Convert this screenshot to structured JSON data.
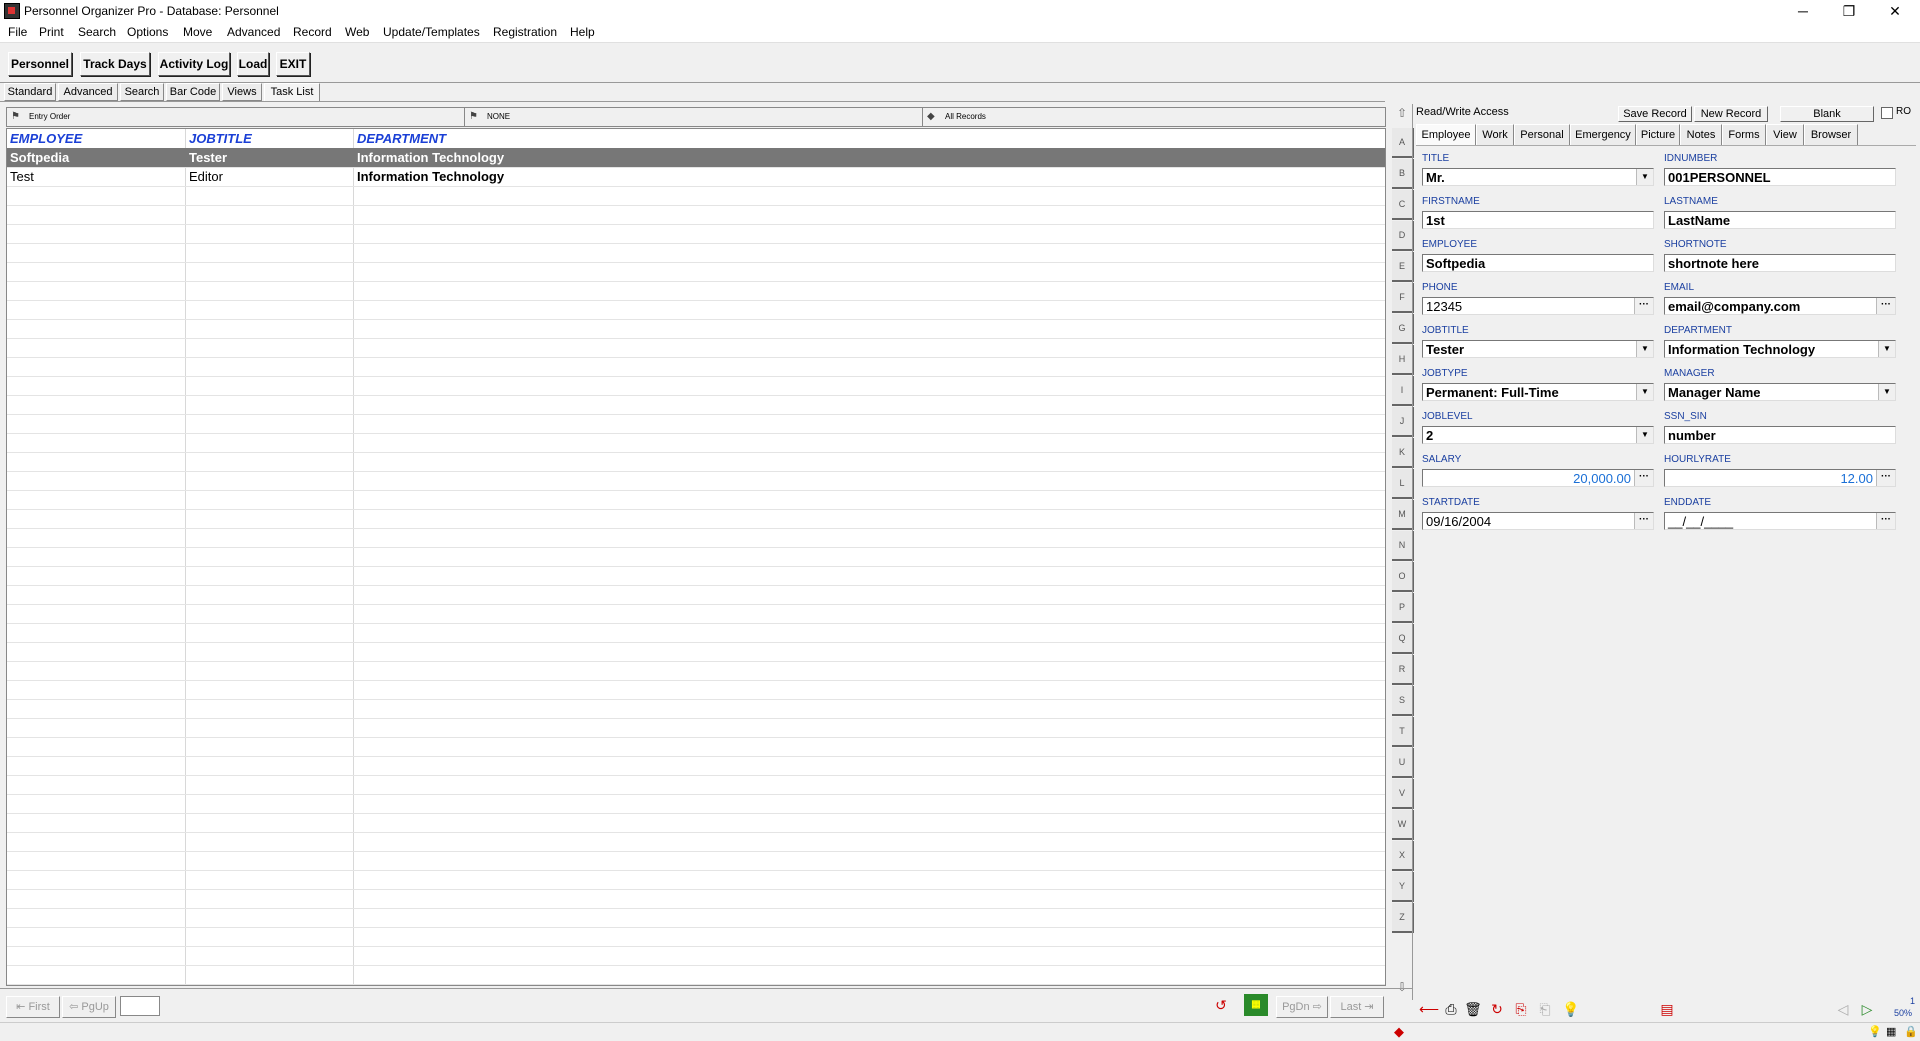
{
  "window": {
    "title": "Personnel Organizer Pro - Database: Personnel",
    "minimize": "─",
    "restore": "❐",
    "close": "✕"
  },
  "menu": [
    "File",
    "Print",
    "Search",
    "Options",
    "Move",
    "Advanced",
    "Record",
    "Web",
    "Update/Templates",
    "Registration",
    "Help"
  ],
  "toolbar": {
    "personnel": "Personnel",
    "track_days": "Track Days",
    "activity_log": "Activity Log",
    "load": "Load",
    "exit": "EXIT"
  },
  "view_tabs": [
    "Standard",
    "Advanced",
    "Search",
    "Bar Code",
    "Views",
    "Task List"
  ],
  "sortbars": {
    "order": "Entry Order",
    "filter": "NONE",
    "records": "All Records"
  },
  "grid": {
    "columns": [
      "EMPLOYEE",
      "JOBTITLE",
      "DEPARTMENT"
    ],
    "rows": [
      [
        "Softpedia",
        "Tester",
        "Information Technology"
      ],
      [
        "Test",
        "Editor",
        "Information Technology"
      ]
    ]
  },
  "alphabet": [
    "A",
    "B",
    "C",
    "D",
    "E",
    "F",
    "G",
    "H",
    "I",
    "J",
    "K",
    "L",
    "M",
    "N",
    "O",
    "P",
    "Q",
    "R",
    "S",
    "T",
    "U",
    "V",
    "W",
    "X",
    "Y",
    "Z"
  ],
  "form": {
    "access": "Read/Write Access",
    "save": "Save Record",
    "new": "New Record",
    "blank": "Blank",
    "ro": "RO",
    "tabs": [
      "Employee",
      "Work",
      "Personal",
      "Emergency",
      "Picture",
      "Notes",
      "Forms",
      "View",
      "Browser"
    ],
    "fields": {
      "title": {
        "label": "TITLE",
        "value": "Mr."
      },
      "idnumber": {
        "label": "IDNUMBER",
        "value": "001PERSONNEL"
      },
      "firstname": {
        "label": "FIRSTNAME",
        "value": "1st"
      },
      "lastname": {
        "label": "LASTNAME",
        "value": "LastName"
      },
      "employee": {
        "label": "EMPLOYEE",
        "value": "Softpedia"
      },
      "shortnote": {
        "label": "SHORTNOTE",
        "value": "shortnote here"
      },
      "phone": {
        "label": "PHONE",
        "value": "12345"
      },
      "email": {
        "label": "EMAIL",
        "value": "email@company.com"
      },
      "jobtitle": {
        "label": "JOBTITLE",
        "value": "Tester"
      },
      "department": {
        "label": "DEPARTMENT",
        "value": "Information Technology"
      },
      "jobtype": {
        "label": "JOBTYPE",
        "value": "Permanent: Full-Time"
      },
      "manager": {
        "label": "MANAGER",
        "value": "Manager Name"
      },
      "joblevel": {
        "label": "JOBLEVEL",
        "value": "2"
      },
      "ssn": {
        "label": "SSN_SIN",
        "value": "number"
      },
      "salary": {
        "label": "SALARY",
        "value": "20,000.00"
      },
      "hourlyrate": {
        "label": "HOURLYRATE",
        "value": "12.00"
      },
      "startdate": {
        "label": "STARTDATE",
        "value": "09/16/2004"
      },
      "enddate": {
        "label": "ENDDATE",
        "value": "__/__/____"
      }
    }
  },
  "nav": {
    "first": "First",
    "pgup": "PgUp",
    "pgdn": "PgDn",
    "last": "Last"
  },
  "status": {
    "page": "1",
    "zoom": "50%"
  }
}
